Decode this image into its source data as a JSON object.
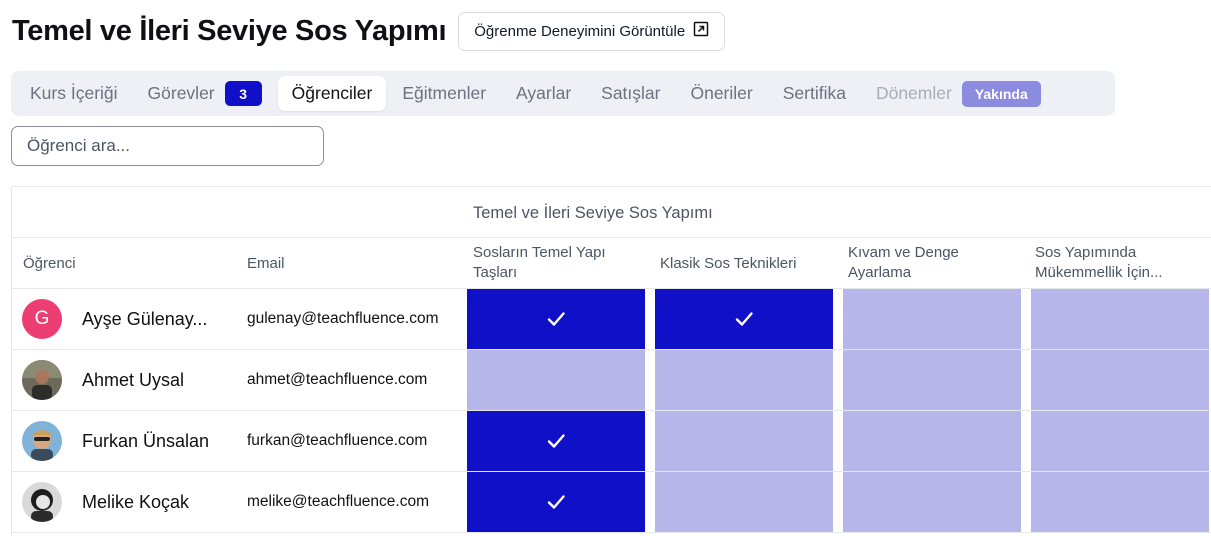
{
  "header": {
    "title": "Temel ve İleri Seviye Sos Yapımı",
    "view_button": "Öğrenme Deneyimini Görüntüle"
  },
  "tabs": [
    {
      "label": "Kurs İçeriği"
    },
    {
      "label": "Görevler",
      "badge": "3"
    },
    {
      "label": "Öğrenciler",
      "active": true
    },
    {
      "label": "Eğitmenler"
    },
    {
      "label": "Ayarlar"
    },
    {
      "label": "Satışlar"
    },
    {
      "label": "Öneriler"
    },
    {
      "label": "Sertifika"
    },
    {
      "label": "Dönemler",
      "disabled": true,
      "badge": "Yakında"
    }
  ],
  "search": {
    "placeholder": "Öğrenci ara...",
    "value": ""
  },
  "table": {
    "group_title": "Temel ve İleri Seviye Sos Yapımı",
    "col_student": "Öğrenci",
    "col_email": "Email",
    "modules": [
      "Sosların Temel Yapı Taşları",
      "Klasik Sos Teknikleri",
      "Kıvam ve Denge Ayarlama",
      "Sos Yapımında Mükemmellik İçin..."
    ],
    "rows": [
      {
        "avatar": "G",
        "name": "Ayşe Gülenay...",
        "email": "gulenay@teachfluence.com",
        "progress": [
          true,
          true,
          false,
          false
        ]
      },
      {
        "avatar": "photo",
        "name": "Ahmet Uysal",
        "email": "ahmet@teachfluence.com",
        "progress": [
          false,
          false,
          false,
          false
        ]
      },
      {
        "avatar": "photo",
        "name": "Furkan Ünsalan",
        "email": "furkan@teachfluence.com",
        "progress": [
          true,
          false,
          false,
          false
        ]
      },
      {
        "avatar": "photo",
        "name": "Melike Koçak",
        "email": "melike@teachfluence.com",
        "progress": [
          true,
          false,
          false,
          false
        ]
      }
    ]
  },
  "colors": {
    "completed": "#1010c8",
    "incomplete": "#b7b6eb",
    "badge": "#1010c8",
    "soon_badge": "#8b8be0",
    "avatar_letter_bg": "#ec3e73"
  },
  "icons": {
    "view_button": "external-link-icon",
    "cell_done": "check-icon"
  }
}
